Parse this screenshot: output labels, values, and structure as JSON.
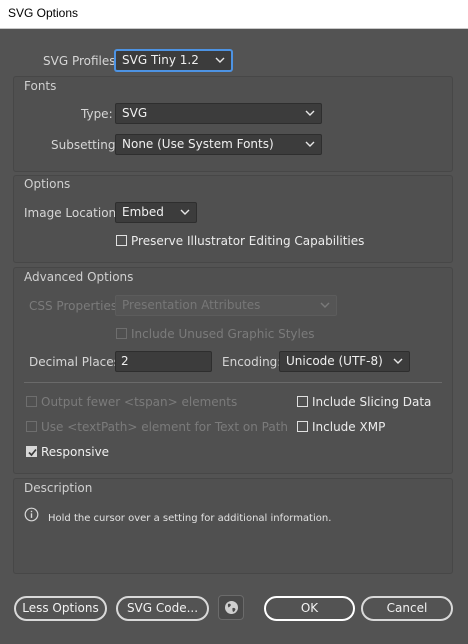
{
  "window": {
    "title": "SVG Options"
  },
  "profiles": {
    "label": "SVG Profiles:",
    "value": "SVG Tiny 1.2"
  },
  "fonts": {
    "section_title": "Fonts",
    "type_label": "Type:",
    "type_value": "SVG",
    "subsetting_label": "Subsetting:",
    "subsetting_value": "None (Use System Fonts)"
  },
  "options": {
    "section_title": "Options",
    "image_location_label": "Image Location:",
    "image_location_value": "Embed",
    "preserve_label": "Preserve Illustrator Editing Capabilities",
    "preserve_checked": false
  },
  "advanced": {
    "section_title": "Advanced Options",
    "css_label": "CSS Properties:",
    "css_value": "Presentation Attributes",
    "unused_styles_label": "Include Unused Graphic Styles",
    "decimal_label": "Decimal Places:",
    "decimal_value": "2",
    "encoding_label": "Encoding:",
    "encoding_value": "Unicode (UTF-8)",
    "tspan_label": "Output fewer <tspan> elements",
    "textpath_label": "Use <textPath> element for Text on Path",
    "slicing_label": "Include Slicing Data",
    "xmp_label": "Include XMP",
    "responsive_label": "Responsive",
    "responsive_checked": true
  },
  "description": {
    "section_title": "Description",
    "text": "Hold the cursor over a setting for additional information.",
    "icon": "info-icon"
  },
  "buttons": {
    "less_options": "Less Options",
    "svg_code": "SVG Code...",
    "globe_icon": "globe-icon",
    "ok": "OK",
    "cancel": "Cancel"
  },
  "colors": {
    "background": "#535353",
    "panel": "#505050",
    "focus": "#4d93e3"
  }
}
